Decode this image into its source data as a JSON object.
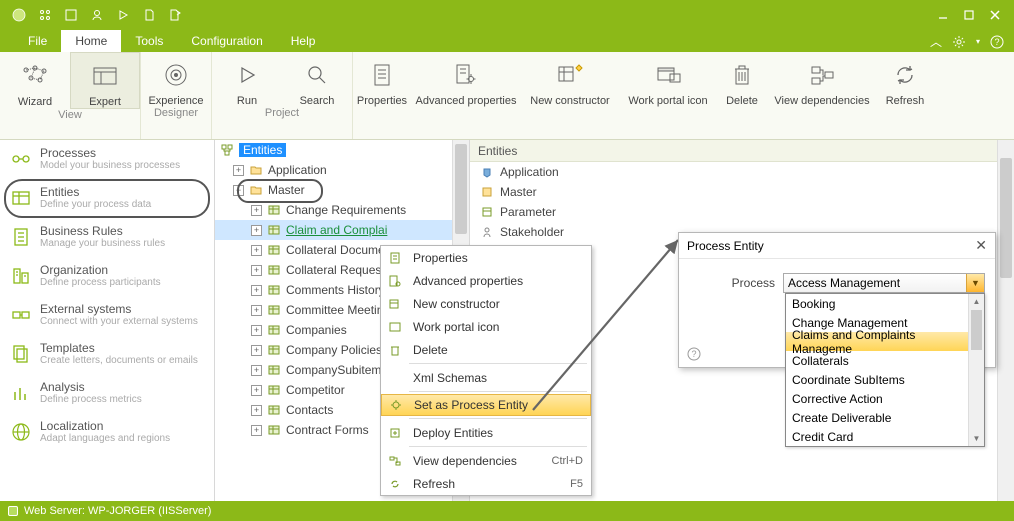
{
  "menubar": {
    "file": "File",
    "home": "Home",
    "tools": "Tools",
    "configuration": "Configuration",
    "help": "Help"
  },
  "ribbon": {
    "wizard": "Wizard",
    "expert": "Expert",
    "experience": "Experience",
    "run": "Run",
    "search": "Search",
    "properties": "Properties",
    "advprops": "Advanced properties",
    "newconstructor": "New constructor",
    "workportal": "Work portal icon",
    "delete": "Delete",
    "viewdeps": "View dependencies",
    "refresh": "Refresh",
    "group_view": "View",
    "group_designer": "Designer",
    "group_project": "Project"
  },
  "sidebar": {
    "processes": {
      "title": "Processes",
      "desc": "Model your business processes"
    },
    "entities": {
      "title": "Entities",
      "desc": "Define your process data"
    },
    "rules": {
      "title": "Business Rules",
      "desc": "Manage your business rules"
    },
    "org": {
      "title": "Organization",
      "desc": "Define process participants"
    },
    "ext": {
      "title": "External systems",
      "desc": "Connect with your external systems"
    },
    "templates": {
      "title": "Templates",
      "desc": "Create letters, documents or emails"
    },
    "analysis": {
      "title": "Analysis",
      "desc": "Define process metrics"
    },
    "local": {
      "title": "Localization",
      "desc": "Adapt languages and regions"
    }
  },
  "tree": {
    "root": "Entities",
    "application": "Application",
    "master": "Master",
    "children": [
      "Change Requirements",
      "Claim and Complai",
      "Collateral Docume",
      "Collateral Request",
      "Comments History",
      "Committee Meetin",
      "Companies",
      "Company Policies",
      "CompanySubitem",
      "Competitor",
      "Contacts",
      "Contract Forms"
    ]
  },
  "rightpane": {
    "header": "Entities",
    "items": [
      "Application",
      "Master",
      "Parameter",
      "Stakeholder"
    ]
  },
  "contextmenu": {
    "properties": "Properties",
    "advprops": "Advanced properties",
    "newconstructor": "New constructor",
    "workportal": "Work portal icon",
    "delete": "Delete",
    "xmlschemas": "Xml Schemas",
    "setprocess": "Set as Process Entity",
    "deploy": "Deploy Entities",
    "viewdeps": "View dependencies",
    "viewdeps_key": "Ctrl+D",
    "refresh": "Refresh",
    "refresh_key": "F5"
  },
  "dialog": {
    "title": "Process Entity",
    "label": "Process",
    "selected": "Access Management",
    "options": [
      "Booking",
      "Change Management",
      "Claims and Complaints Manageme",
      "Collaterals",
      "Coordinate SubItems",
      "Corrective Action",
      "Create Deliverable",
      "Credit Card"
    ],
    "highlighted_index": 2
  },
  "statusbar": {
    "text": "Web Server: WP-JORGER (IISServer)"
  }
}
